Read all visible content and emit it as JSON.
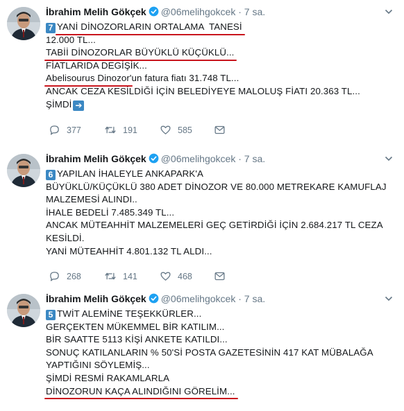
{
  "tweets": [
    {
      "author_name": "İbrahim Melih Gökçek",
      "handle": "@06melihgokcek",
      "dot": "·",
      "time": "7 sa.",
      "badge": "7",
      "lines": [
        "YANİ DİNOZORLARIN ORTALAMA  TANESİ",
        "12.000 TL...",
        "TABİİ DİNOZORLAR BÜYÜKLÜ KÜÇÜKLÜ...",
        "FİATLARIDA DEGİŞİK...",
        "Abelisourus Dinozor",
        "'un fatura fiatı 31.748 TL...",
        "ANCAK CEZA KESİLDİĞİ İÇİN BELEDİYEYE MALOLUŞ FİATI 20.363 TL...",
        "ŞİMDİ"
      ],
      "replies": "377",
      "retweets": "191",
      "likes": "585"
    },
    {
      "author_name": "İbrahim Melih Gökçek",
      "handle": "@06melihgokcek",
      "dot": "·",
      "time": "7 sa.",
      "badge": "6",
      "lines": [
        "YAPILAN İHALEYLE ANKAPARK'A",
        "BÜYÜKLÜ/KÜÇÜKLÜ 380 ADET DİNOZOR VE 80.000 METREKARE KAMUFLAJ",
        "MALZEMESİ ALINDI..",
        "İHALE BEDELİ 7.485.349 TL...",
        "ANCAK MÜTEAHHİT MALZEMELERİ GEÇ GETİRDİĞİ İÇİN 2.684.217 TL CEZA",
        "KESİLDİ.",
        "YANİ MÜTEAHHİT 4.801.132 TL ALDI..."
      ],
      "replies": "268",
      "retweets": "141",
      "likes": "468"
    },
    {
      "author_name": "İbrahim Melih Gökçek",
      "handle": "@06melihgokcek",
      "dot": "·",
      "time": "7 sa.",
      "badge": "5",
      "lines": [
        "TWİT ALEMİNE TEŞEKKÜRLER...",
        "GERÇEKTEN MÜKEMMEL BİR KATILIM...",
        "BİR SAATTE 5113 KİŞİ ANKETE KATILDI...",
        "SONUÇ KATILANLARIN % 50'Sİ POSTA GAZETESİNİN 417 KAT MÜBALAĞA",
        "YAPTIĞINI SÖYLEMİŞ...",
        "ŞİMDİ RESMİ RAKAMLARLA",
        "DİNOZORUN KAÇA ALINDIĞINI GÖRELİM..."
      ]
    }
  ],
  "icons": {
    "verified": "verified-badge-icon",
    "reply": "reply-icon",
    "retweet": "retweet-icon",
    "like": "heart-icon",
    "message": "envelope-icon",
    "more": "chevron-down-icon",
    "arrow": "right-arrow-emoji"
  },
  "colors": {
    "underline": "#c9151d",
    "link_blue": "#1da1f2",
    "muted": "#657786",
    "emoji_blue": "#3b88c3"
  }
}
